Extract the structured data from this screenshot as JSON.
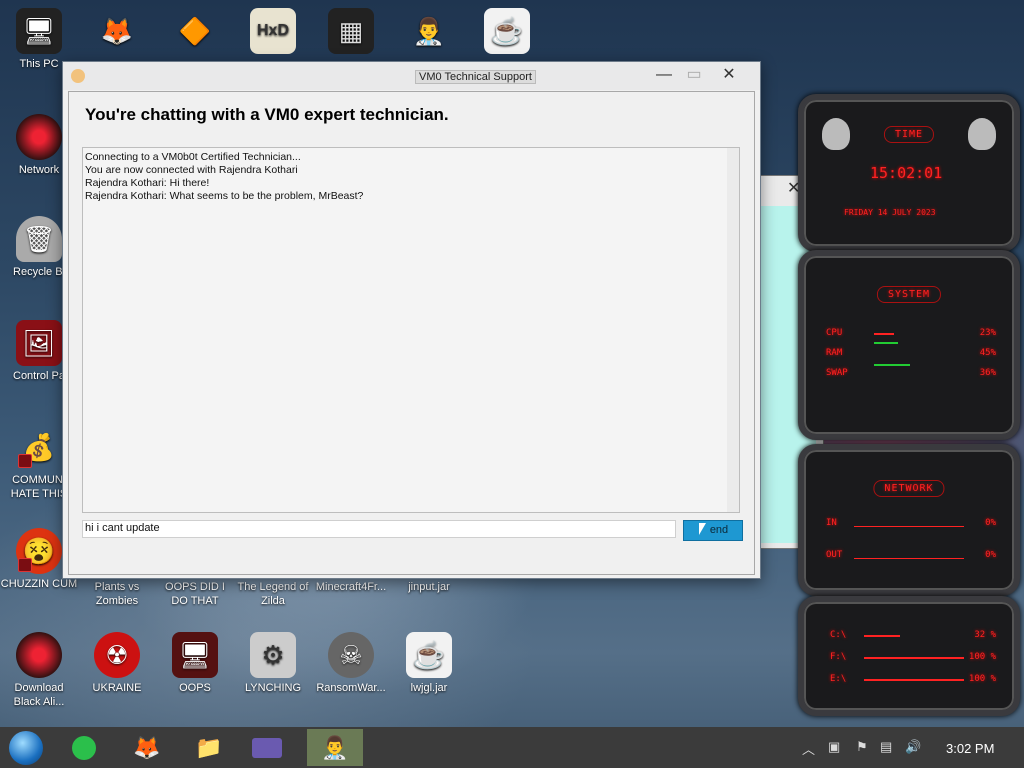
{
  "desktop": {
    "icons_left": [
      {
        "label": "This PC",
        "glyph": "🖥"
      },
      {
        "label": "Network",
        "glyph": "🔴"
      },
      {
        "label": "Recycle Bi",
        "glyph": "🗑"
      },
      {
        "label": "Control Pa",
        "glyph": "🖼"
      },
      {
        "label": "COMMUNI HATE THIS",
        "glyph": "💰"
      },
      {
        "label": "CHUZZIN CUM",
        "glyph": "😵"
      },
      {
        "label": "Download Black Ali...",
        "glyph": "🔴"
      }
    ],
    "icons_top": [
      {
        "glyph": "🦊"
      },
      {
        "glyph": "🔶"
      },
      {
        "glyph": "HxD"
      },
      {
        "glyph": "▦"
      },
      {
        "glyph": "👨‍⚕️"
      },
      {
        "glyph": "☕"
      }
    ],
    "icons_row1": [
      {
        "label": "Plants vs Zombies"
      },
      {
        "label": "OOPS DID I DO THAT"
      },
      {
        "label": "The Legend of Zilda"
      },
      {
        "label": "Minecraft4Fr..."
      },
      {
        "label": "jinput.jar"
      }
    ],
    "icons_row2": [
      {
        "label": "UKRAINE",
        "glyph": "☢"
      },
      {
        "label": "OOPS",
        "glyph": "🖥"
      },
      {
        "label": "LYNCHING",
        "glyph": "⚙"
      },
      {
        "label": "RansomWar...",
        "glyph": "☠"
      },
      {
        "label": "lwjgl.jar",
        "glyph": "☕"
      }
    ]
  },
  "window": {
    "title": "VM0 Technical Support",
    "heading": "You're chatting with a VM0 expert technician.",
    "chat_lines": [
      "Connecting to a VM0b0t Certified Technician...",
      "You are now connected with Rajendra Kothari",
      "Rajendra Kothari: Hi there!",
      "Rajendra Kothari: What seems to be the problem, MrBeast?"
    ],
    "message_value": "hi i cant update",
    "send_label": "end",
    "close_glyph": "✕",
    "minimize_glyph": "—",
    "maximize_glyph": "▭"
  },
  "gadgets": {
    "time_header": "TIME",
    "time": "15:02:01",
    "date": "FRIDAY 14 JULY 2023",
    "system_header": "SYSTEM",
    "cpu_label": "CPU",
    "cpu_value": "23%",
    "ram_label": "RAM",
    "ram_value": "45%",
    "swap_label": "SWAP",
    "swap_value": "36%",
    "network_header": "NETWORK",
    "in_label": "IN",
    "in_value": "0%",
    "out_label": "OUT",
    "out_value": "0%",
    "c_label": "C:\\",
    "c_value": "32 %",
    "f_label": "F:\\",
    "f_value": "100 %",
    "e_label": "E:\\",
    "e_value": "100 %"
  },
  "taskbar": {
    "clock": "3:02 PM",
    "colors": {
      "bar": "#3b3b3b",
      "active": "#6a7a55"
    }
  }
}
